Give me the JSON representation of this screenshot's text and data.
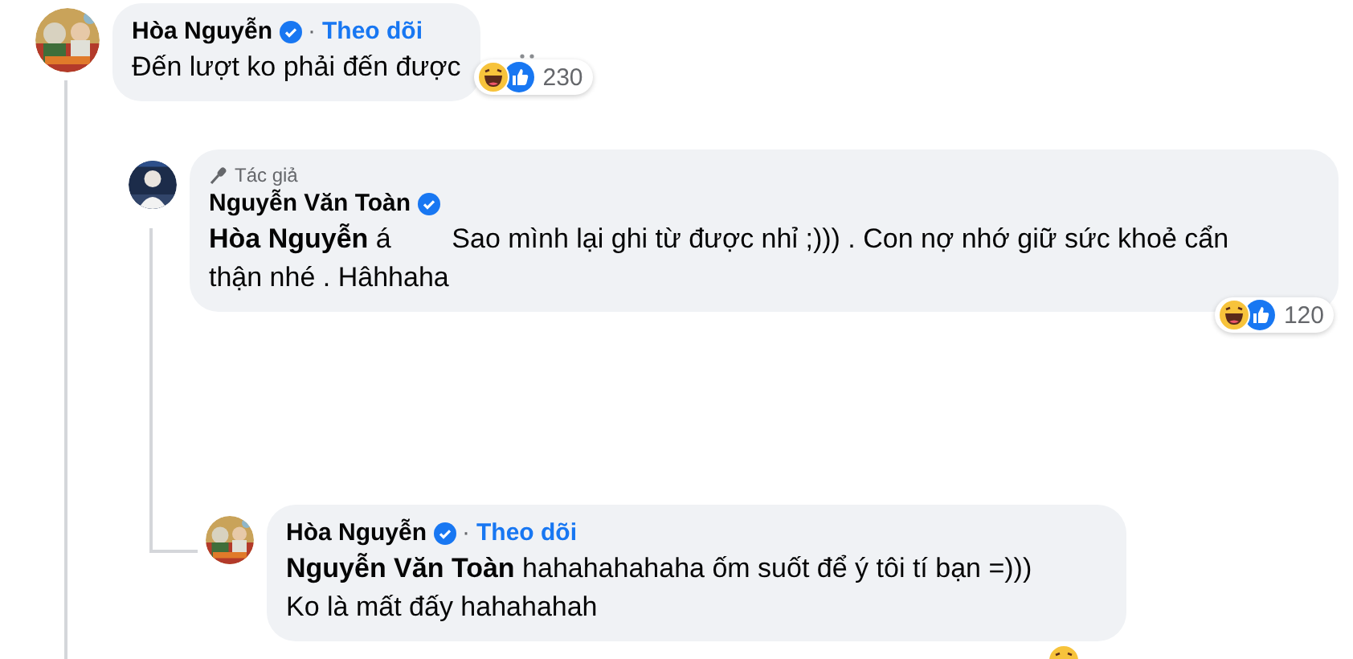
{
  "comments": [
    {
      "author": "Hòa Nguyễn",
      "verified": true,
      "separator": "·",
      "follow": "Theo dõi",
      "text": "Đến lượt ko phải đến được",
      "reaction_count": "230",
      "children": [
        {
          "author": "Nguyễn Văn Toàn",
          "verified": true,
          "badge": "Tác giả",
          "text": "**Hòa Nguyễn** á        Sao mình lại ghi từ được nhỉ ;))) . Con nợ nhớ giữ sức khoẻ cẩn thận nhé . Hâhhaha",
          "reaction_count": "120",
          "children": [
            {
              "author": "Hòa Nguyễn",
              "verified": true,
              "separator": "·",
              "follow": "Theo dõi",
              "text": "**Nguyễn Văn Toàn** hahahahahaha ốm suốt để ý tôi tí bạn =)))\nKo là mất đấy hahahahah"
            }
          ]
        }
      ]
    }
  ]
}
